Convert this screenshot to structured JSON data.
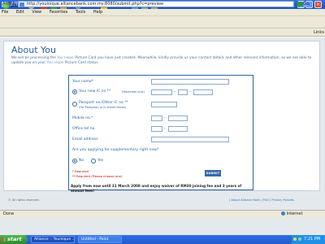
{
  "window": {
    "title": "Alliance :: Youinique - Microsoft Internet Explorer"
  },
  "menu": [
    "File",
    "Edit",
    "View",
    "Favorites",
    "Tools",
    "Help"
  ],
  "toolbar": {
    "back": "Back",
    "search": "Search",
    "favorites": "Favorites"
  },
  "address": {
    "label": "Address",
    "value": "http://youinique.alliancebank.com.my:8080/submit.php?c=preview",
    "go": "Go",
    "links": "Links"
  },
  "page": {
    "heading": "About You",
    "intro_start": "We will be processing the",
    "brand": "You nique",
    "intro_mid": "Picture Card you have just created. Meanwhile, kindly provide us your contact details and other relevant information, so we are able to update you on your",
    "intro_end": "Picture Card status."
  },
  "form": {
    "name_label": "Your name*",
    "newic_label": "Your new IC no **",
    "newic_hint": "(Malaysian only)",
    "passport_label": "Passport no./Other IC no **",
    "passport_hint": "(For Malaysian or in armed forces)",
    "mobile_label": "Mobile no.*",
    "office_label": "Office tel no.",
    "email_label": "Email address",
    "supp_question": "Are you applying for supplementary right now?",
    "no_label": "No",
    "yes_label": "Yes",
    "required1": "* Required",
    "required2": "** Required (Please choose one)",
    "submit": "SUBMIT",
    "promo": "Apply from now until 31 March 2008 and enjoy waiver of RM30 joining fee and 3 years of annual fees!"
  },
  "footer": {
    "copyright": "© All rights reserved.",
    "links": "| About Alliance Bank | FAQ | Privacy Policies"
  },
  "status": {
    "left": "Done",
    "zone": "Internet"
  },
  "taskbar": {
    "start": "start",
    "task1": "Alliance :: Youinique ...",
    "task2": "Untitled - Paint",
    "clock": "7:21 PM"
  }
}
